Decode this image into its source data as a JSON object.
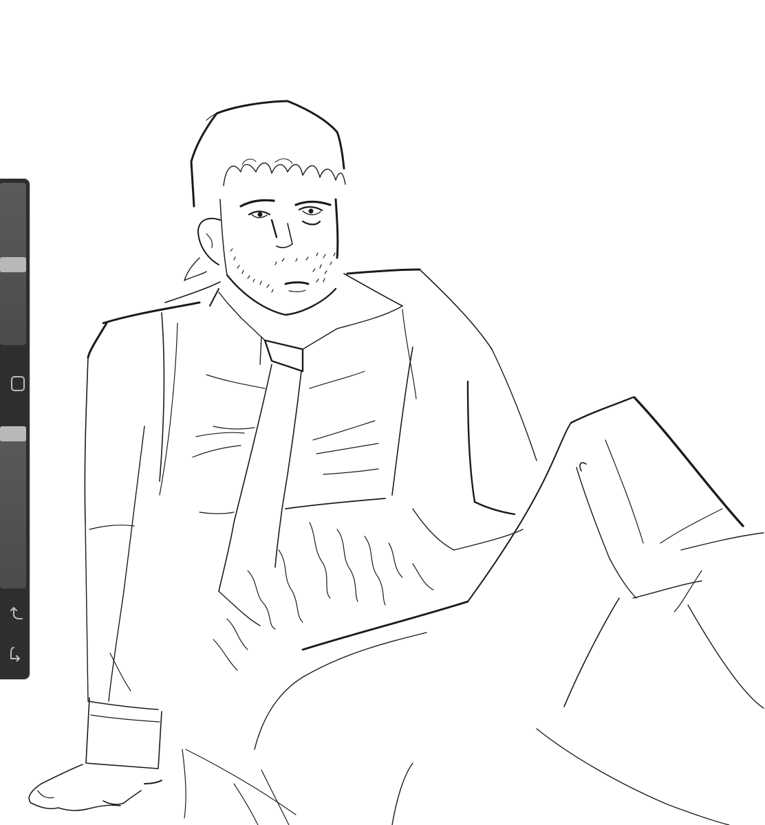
{
  "app": {
    "canvas_background": "#ffffff",
    "stroke_color": "#1a1a1a"
  },
  "sidebar": {
    "background": "#2e2e2e",
    "brush_size_slider": {
      "label": "",
      "value": 0.5
    },
    "modify_button": {
      "icon": "square-icon"
    },
    "brush_opacity_slider": {
      "label": "",
      "value": 0.95
    },
    "undo_button": {
      "icon": "undo-arrow-icon"
    },
    "redo_button": {
      "icon": "redo-arrow-icon"
    }
  }
}
